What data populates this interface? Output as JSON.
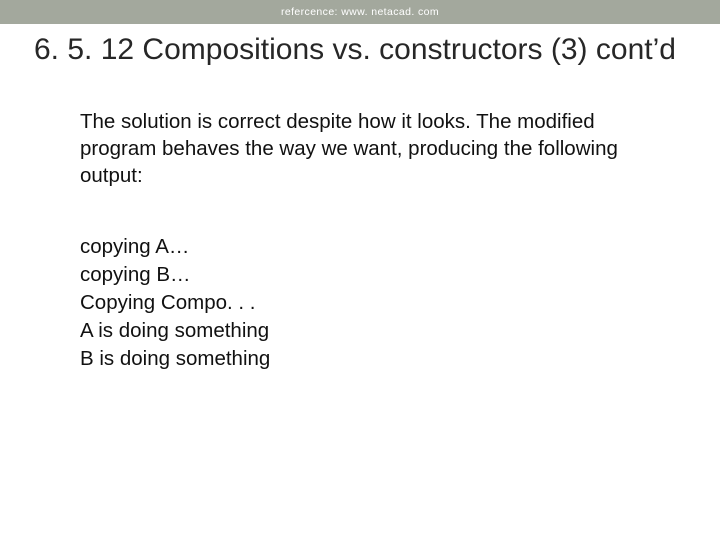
{
  "reference": "refercence: www. netacad. com",
  "title": "6. 5. 12 Compositions vs. constructors (3) cont’d",
  "paragraph": "The solution is correct despite how it looks. The modified program behaves the way we want, producing the following output:",
  "output": [
    "copying A…",
    "copying B…",
    "Copying Compo. . .",
    "A is doing something",
    "B is doing something"
  ]
}
